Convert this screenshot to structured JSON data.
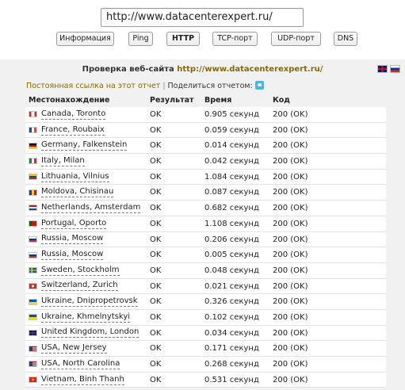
{
  "url_field": {
    "value": "http://www.datacenterexpert.ru/"
  },
  "toolbar": {
    "buttons": [
      {
        "label": "Информация"
      },
      {
        "label": "Ping"
      },
      {
        "label": "HTTP",
        "active": true
      },
      {
        "label": "TCP-порт"
      },
      {
        "label": "UDP-порт"
      },
      {
        "label": "DNS"
      }
    ]
  },
  "panel": {
    "title_prefix": "Проверка веб-сайта",
    "site": "http://www.datacenterexpert.ru/",
    "lang_icons": [
      "uk-flag-icon",
      "russia-flag-icon"
    ],
    "permalink_label": "Постоянная ссылка на этот отчет",
    "separator": "|",
    "share_label": "Поделиться отчетом:",
    "share_icon": "twitter-icon"
  },
  "table": {
    "headers": {
      "location": "Местонахождение",
      "result": "Результат",
      "time": "Время",
      "code": "Код"
    },
    "rows": [
      {
        "flag": "ca",
        "location": "Canada, Toronto",
        "result": "OK",
        "time": "0.905 секунд",
        "code": "200 (OK)"
      },
      {
        "flag": "fr",
        "location": "France, Roubaix",
        "result": "OK",
        "time": "0.059 секунд",
        "code": "200 (OK)"
      },
      {
        "flag": "de",
        "location": "Germany, Falkenstein",
        "result": "OK",
        "time": "0.014 секунд",
        "code": "200 (OK)"
      },
      {
        "flag": "it",
        "location": "Italy, Milan",
        "result": "OK",
        "time": "0.042 секунд",
        "code": "200 (OK)"
      },
      {
        "flag": "lt",
        "location": "Lithuania, Vilnius",
        "result": "OK",
        "time": "1.084 секунд",
        "code": "200 (OK)"
      },
      {
        "flag": "md",
        "location": "Moldova, Chisinau",
        "result": "OK",
        "time": "0.087 секунд",
        "code": "200 (OK)"
      },
      {
        "flag": "nl",
        "location": "Netherlands, Amsterdam",
        "result": "OK",
        "time": "0.682 секунд",
        "code": "200 (OK)"
      },
      {
        "flag": "pt",
        "location": "Portugal, Oporto",
        "result": "OK",
        "time": "1.108 секунд",
        "code": "200 (OK)"
      },
      {
        "flag": "ru",
        "location": "Russia, Moscow",
        "result": "OK",
        "time": "0.206 секунд",
        "code": "200 (OK)"
      },
      {
        "flag": "ru",
        "location": "Russia, Moscow",
        "result": "OK",
        "time": "0.005 секунд",
        "code": "200 (OK)"
      },
      {
        "flag": "se",
        "location": "Sweden, Stockholm",
        "result": "OK",
        "time": "0.048 секунд",
        "code": "200 (OK)"
      },
      {
        "flag": "ch",
        "location": "Switzerland, Zurich",
        "result": "OK",
        "time": "0.021 секунд",
        "code": "200 (OK)"
      },
      {
        "flag": "ua",
        "location": "Ukraine, Dnipropetrovsk",
        "result": "OK",
        "time": "0.326 секунд",
        "code": "200 (OK)"
      },
      {
        "flag": "ua",
        "location": "Ukraine, Khmelnytskyi",
        "result": "OK",
        "time": "0.102 секунд",
        "code": "200 (OK)"
      },
      {
        "flag": "gb",
        "location": "United Kingdom, London",
        "result": "OK",
        "time": "0.034 секунд",
        "code": "200 (OK)"
      },
      {
        "flag": "us",
        "location": "USA, New Jersey",
        "result": "OK",
        "time": "0.171 секунд",
        "code": "200 (OK)"
      },
      {
        "flag": "us",
        "location": "USA, North Carolina",
        "result": "OK",
        "time": "0.268 секунд",
        "code": "200 (OK)"
      },
      {
        "flag": "vn",
        "location": "Vietnam, Binh Thanh",
        "result": "OK",
        "time": "0.531 секунд",
        "code": "200 (OK)"
      }
    ]
  },
  "colors": {
    "accent": "#8a6a00",
    "panel_bg": "#f1f1f1",
    "row_border": "#e2e2e2"
  }
}
